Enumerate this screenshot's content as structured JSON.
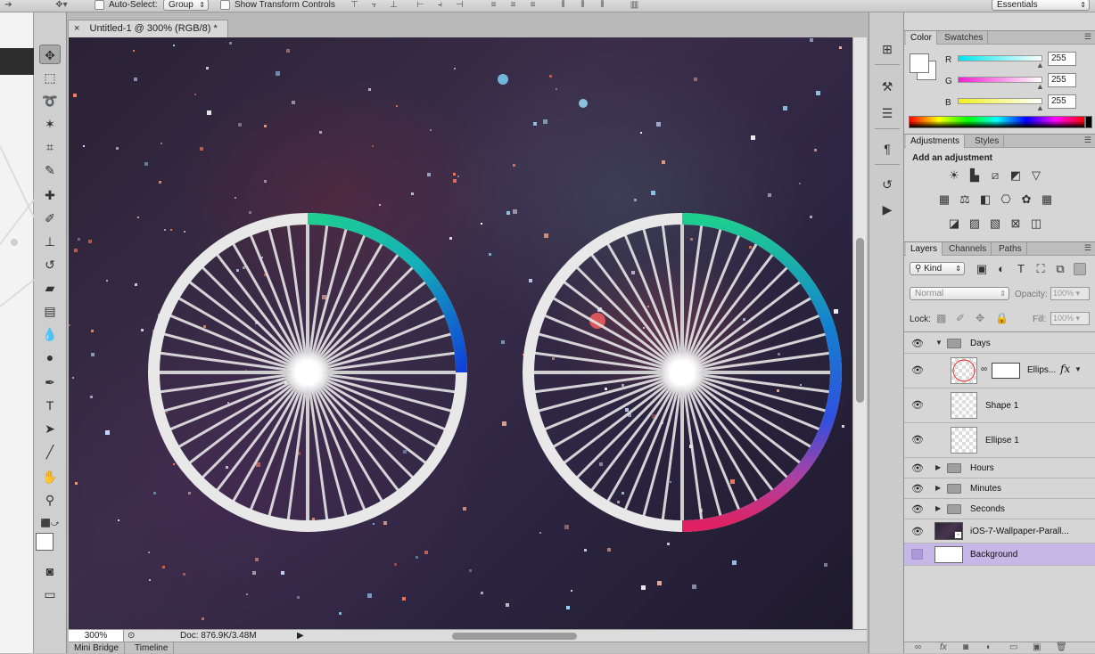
{
  "options_bar": {
    "auto_select_label": "Auto-Select:",
    "auto_select_value": "Group",
    "show_transform_label": "Show Transform Controls",
    "workspace": "Essentials"
  },
  "document": {
    "tab_title": "Untitled-1 @ 300% (RGB/8) *",
    "close_glyph": "×",
    "zoom": "300%",
    "doc_info": "Doc: 876.9K/3.48M"
  },
  "bottom_tabs": [
    "Mini Bridge",
    "Timeline"
  ],
  "color_panel": {
    "tabs": [
      "Color",
      "Swatches"
    ],
    "channels": [
      {
        "label": "R",
        "value": "255",
        "color": "#00e5f0"
      },
      {
        "label": "G",
        "value": "255",
        "color": "#f020d0"
      },
      {
        "label": "B",
        "value": "255",
        "color": "#f0f020"
      }
    ]
  },
  "adjustments_panel": {
    "tabs": [
      "Adjustments",
      "Styles"
    ],
    "heading": "Add an adjustment"
  },
  "layers_panel": {
    "tabs": [
      "Layers",
      "Channels",
      "Paths"
    ],
    "filter_kind": "Kind",
    "blend_mode": "Normal",
    "opacity_label": "Opacity:",
    "opacity_value": "100%",
    "lock_label": "Lock:",
    "fill_label": "Fill:",
    "fill_value": "100%",
    "fx_label": "fx",
    "layers": [
      {
        "name": "Days",
        "type": "group-open"
      },
      {
        "name": "Ellips...",
        "type": "shape-mask"
      },
      {
        "name": "Shape 1",
        "type": "shape"
      },
      {
        "name": "Ellipse 1",
        "type": "shape"
      },
      {
        "name": "Hours",
        "type": "group"
      },
      {
        "name": "Minutes",
        "type": "group"
      },
      {
        "name": "Seconds",
        "type": "group"
      },
      {
        "name": "iOS-7-Wallpaper-Parall...",
        "type": "smart"
      },
      {
        "name": "Background",
        "type": "background"
      }
    ]
  },
  "canvas_art": {
    "rings": [
      {
        "arc_start": "#1ecf8f",
        "arc_end": "#1040d8",
        "arc_degrees": 90
      },
      {
        "arc_start": "#1ecf8f",
        "arc_end": "#e02060",
        "arc_degrees": 180
      }
    ]
  }
}
